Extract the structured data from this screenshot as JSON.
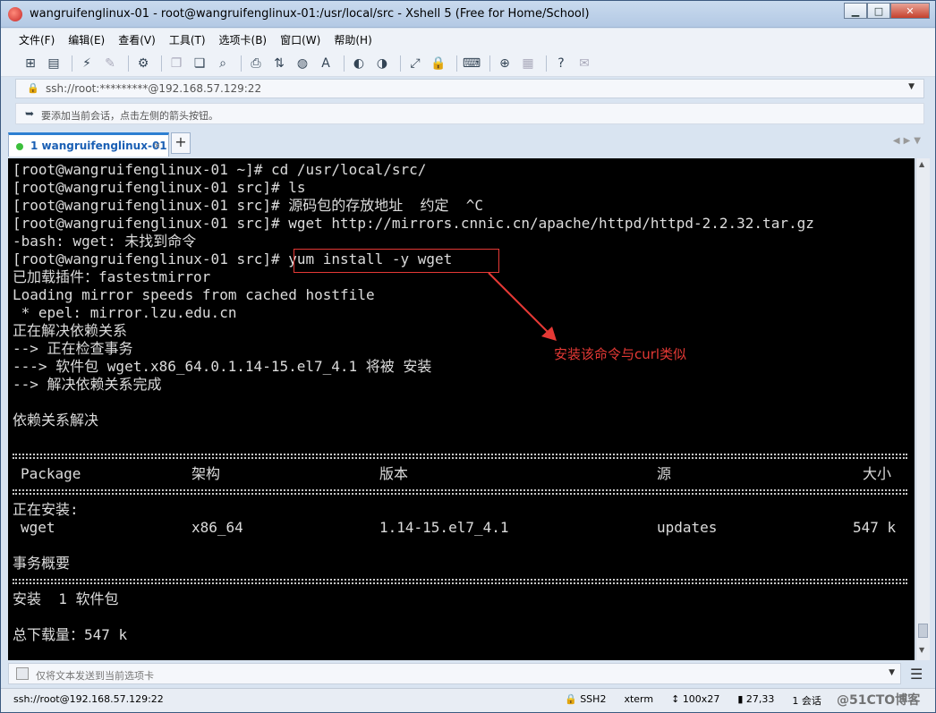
{
  "window": {
    "title": "wangruifenglinux-01 - root@wangruifenglinux-01:/usr/local/src - Xshell 5 (Free for Home/School)",
    "buttons": {
      "minimize": "▁",
      "maximize": "□",
      "close": "✕"
    }
  },
  "menu": [
    "文件(F)",
    "编辑(E)",
    "查看(V)",
    "工具(T)",
    "选项卡(B)",
    "窗口(W)",
    "帮助(H)"
  ],
  "address": {
    "text": "ssh://root:*********@192.168.57.129:22"
  },
  "hint": {
    "text": "要添加当前会话，点击左侧的箭头按钮。"
  },
  "tab": {
    "label": "1 wangruifenglinux-01",
    "close": "×",
    "add": "+"
  },
  "terminal": {
    "lines": [
      "[root@wangruifenglinux-01 ~]# cd /usr/local/src/",
      "[root@wangruifenglinux-01 src]# ls",
      "[root@wangruifenglinux-01 src]# 源码包的存放地址  约定  ^C",
      "[root@wangruifenglinux-01 src]# wget http://mirrors.cnnic.cn/apache/httpd/httpd-2.2.32.tar.gz",
      "-bash: wget: 未找到命令",
      "[root@wangruifenglinux-01 src]# yum install -y wget",
      "已加载插件：fastestmirror",
      "Loading mirror speeds from cached hostfile",
      " * epel: mirror.lzu.edu.cn",
      "正在解决依赖关系",
      "--> 正在检查事务",
      "---> 软件包 wget.x86_64.0.1.14-15.el7_4.1 将被 安装",
      "--> 解决依赖关系完成",
      "",
      "依赖关系解决"
    ],
    "table_header": [
      "Package",
      "架构",
      "版本",
      "源",
      "大小"
    ],
    "installing_label": "正在安装:",
    "table_row": [
      "wget",
      "x86_64",
      "1.14-15.el7_4.1",
      "updates",
      "547 k"
    ],
    "summary_label": "事务概要",
    "install_count": "安装  1 软件包",
    "total_download": "总下载量：547 k"
  },
  "annotation": {
    "text": "安装该命令与curl类似",
    "color": "#e53935"
  },
  "sendbar": {
    "placeholder": "仅将文本发送到当前选项卡"
  },
  "status": {
    "connection": "ssh://root@192.168.57.129:22",
    "protocol": "SSH2",
    "term": "xterm",
    "size": "100x27",
    "cursor": "27,33",
    "sessions": "1 会话"
  },
  "watermark": "@51CTO博客"
}
